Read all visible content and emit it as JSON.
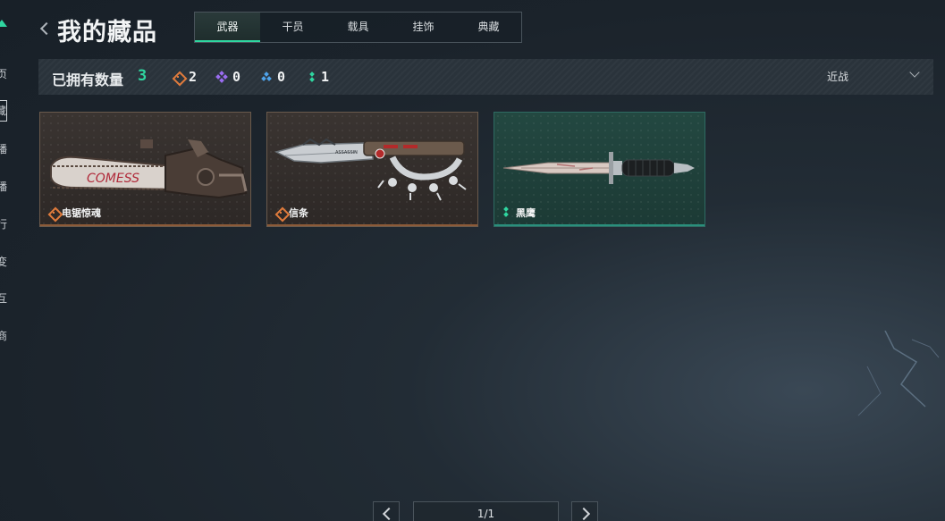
{
  "sidebar": {
    "items": [
      {
        "label": "页",
        "active": false
      },
      {
        "label": "藏",
        "active": true
      },
      {
        "label": "播",
        "active": false
      },
      {
        "label": "播",
        "active": false
      },
      {
        "label": "行",
        "active": false
      },
      {
        "label": "变",
        "active": false
      },
      {
        "label": "互",
        "active": false
      },
      {
        "label": "商",
        "active": false
      }
    ]
  },
  "header": {
    "title": "我的藏品",
    "tabs": [
      {
        "label": "武器",
        "active": true
      },
      {
        "label": "干员",
        "active": false
      },
      {
        "label": "载具",
        "active": false
      },
      {
        "label": "挂饰",
        "active": false
      },
      {
        "label": "典藏",
        "active": false
      }
    ]
  },
  "stats": {
    "owned_label": "已拥有数量",
    "owned_count": "3",
    "rarities": [
      {
        "icon": "orange-diamond-icon",
        "color": "#e07b3c",
        "count": "2"
      },
      {
        "icon": "purple-diamond-icon",
        "color": "#9a6cf0",
        "count": "0"
      },
      {
        "icon": "blue-diamond-icon",
        "color": "#4fa3ea",
        "count": "0"
      },
      {
        "icon": "green-diamond-icon",
        "color": "#2fd6a0",
        "count": "1"
      }
    ],
    "filter_value": "近战"
  },
  "items": [
    {
      "name": "电锯惊魂",
      "rarity": "orange",
      "icon": "chainsaw-icon",
      "decal_text": "COMESS"
    },
    {
      "name": "信条",
      "rarity": "orange",
      "icon": "knuckle-knife-icon",
      "decal_text": "ASSASSIN"
    },
    {
      "name": "黑鹰",
      "rarity": "green",
      "icon": "dagger-icon"
    }
  ],
  "pagination": {
    "indicator": "1/1"
  },
  "colors": {
    "accent": "#2fd6a0",
    "orange": "#e07b3c",
    "purple": "#9a6cf0",
    "blue": "#4fa3ea"
  }
}
